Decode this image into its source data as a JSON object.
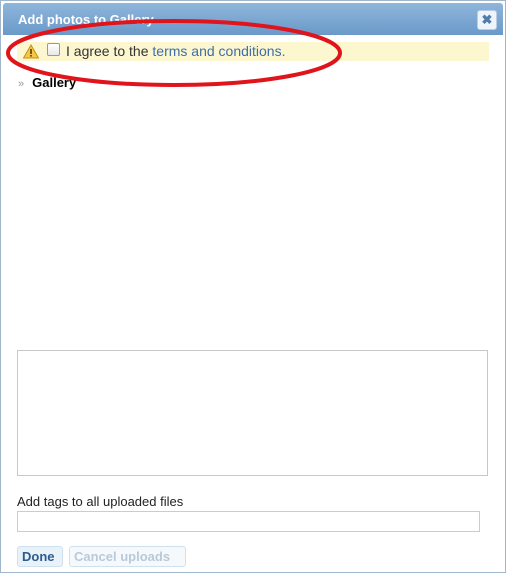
{
  "dialog": {
    "title": "Add photos to Gallery",
    "close_icon": "close-icon"
  },
  "notice": {
    "icon": "warning-icon",
    "text_prefix": "I agree to the ",
    "link_text": "terms and conditions.",
    "checked": false
  },
  "breadcrumb": {
    "separator": "»",
    "label": "Gallery"
  },
  "tags": {
    "label": "Add tags to all uploaded files",
    "value": ""
  },
  "buttons": {
    "done": "Done",
    "cancel": "Cancel uploads"
  },
  "colors": {
    "titlebar": "#6a99c9",
    "notice_bg": "#fdf7d0",
    "link": "#3d6ea8",
    "annotation": "#e0141b"
  }
}
